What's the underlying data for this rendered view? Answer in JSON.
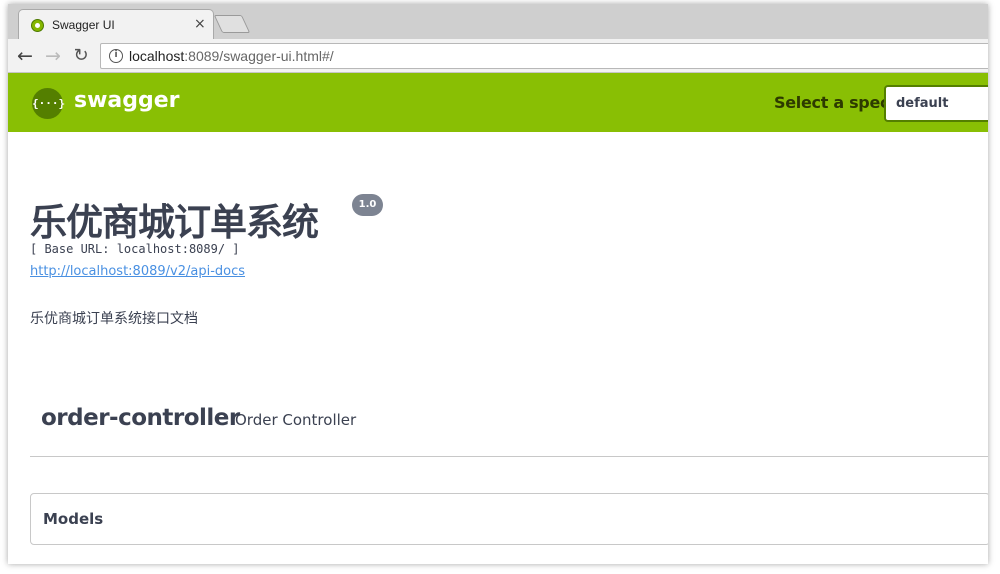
{
  "browser": {
    "tab_title": "Swagger UI",
    "tab_close": "×",
    "back": "←",
    "forward": "→",
    "reload": "↻",
    "url_host": "localhost",
    "url_rest": ":8089/swagger-ui.html#/",
    "info": "i"
  },
  "topbar": {
    "logo_icon": "{···}",
    "logo_text": "swagger",
    "spec_label": "Select a spec",
    "spec_value": "default"
  },
  "info": {
    "title": "乐优商城订单系统",
    "version": "1.0",
    "base_url": "[ Base URL: localhost:8089/ ]",
    "api_docs_link": "http://localhost:8089/v2/api-docs",
    "description": "乐优商城订单系统接口文档"
  },
  "tag": {
    "name": "order-controller",
    "description": "Order Controller"
  },
  "models": {
    "title": "Models"
  },
  "colors": {
    "swagger_green": "#89bf04",
    "dark_text": "#3b4151",
    "link": "#4990e2"
  }
}
